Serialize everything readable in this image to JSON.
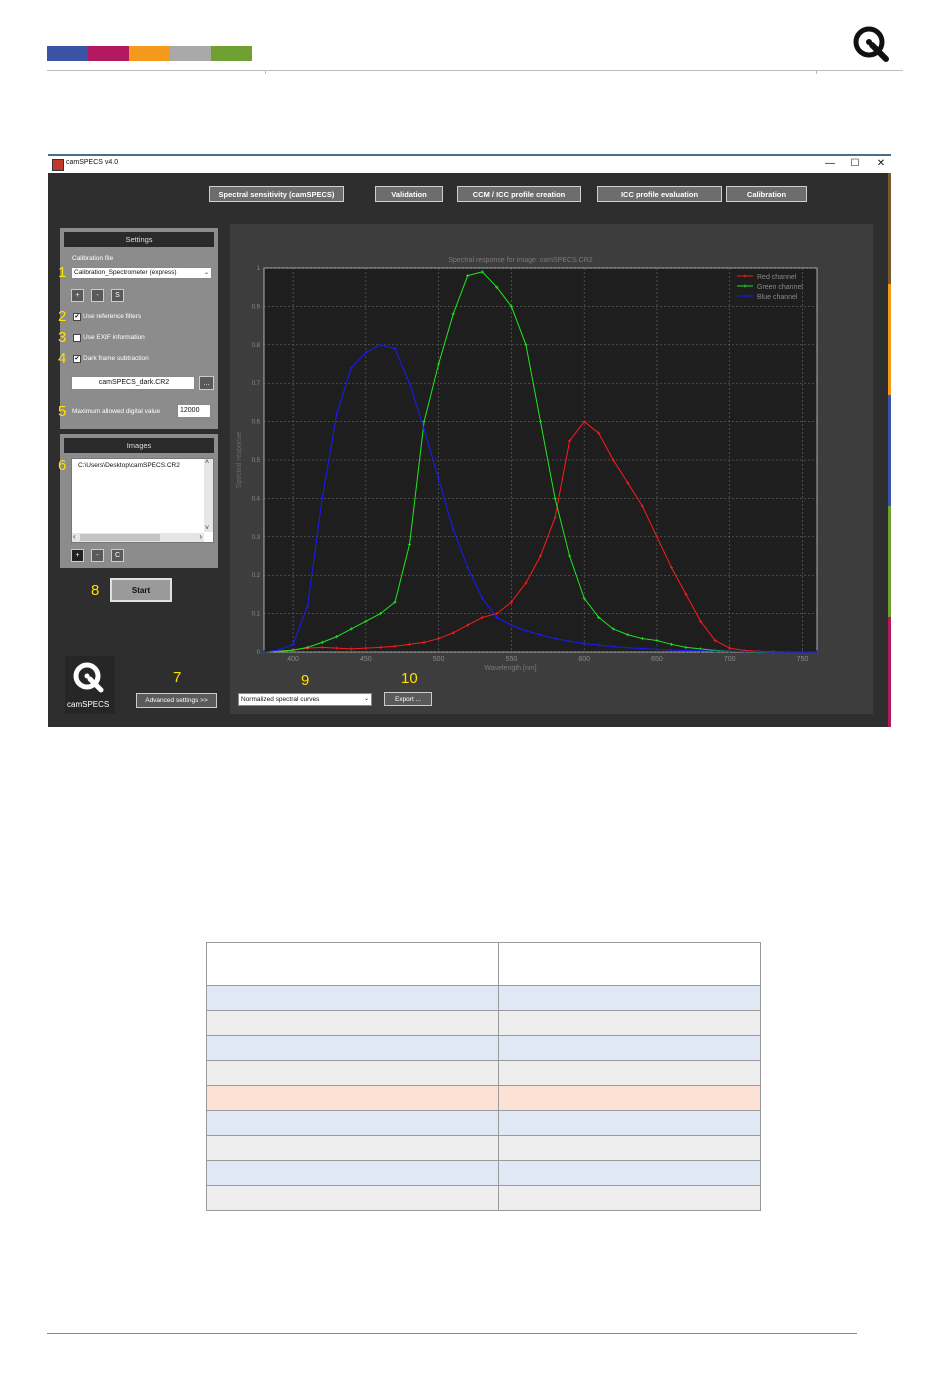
{
  "header": {
    "color_bar": [
      "#3a53a4",
      "#b3195f",
      "#f39a1c",
      "#a9a9a9",
      "#6fa033"
    ],
    "logo_icon": "image-engineering-logo-icon"
  },
  "window": {
    "title": "camSPECS v4.0",
    "controls": {
      "minimize": "—",
      "maximize": "☐",
      "close": "✕"
    },
    "side_colors": [
      "#7a5a2a",
      "#f39a1c",
      "#3a53a4",
      "#6fa033",
      "#b3195f"
    ]
  },
  "top_buttons": [
    "Spectral sensitivity (camSPECS)",
    "Validation",
    "CCM / ICC profile creation",
    "ICC profile evaluation",
    "Calibration"
  ],
  "settings": {
    "title": "Settings",
    "calibration_label": "Calibration file",
    "calibration_value": "Calibration_Spectrometer (express)",
    "cal_buttons": [
      "+",
      "-",
      "S"
    ],
    "use_reference_filters": {
      "label": "Use reference filters",
      "checked": "✔"
    },
    "use_exif": {
      "label": "Use EXIF information",
      "checked": ""
    },
    "dark_frame": {
      "label": "Dark frame subtraction",
      "checked": "✔"
    },
    "dark_file": "camSPECS_dark.CR2",
    "browse": "...",
    "max_label": "Maximum allowed digital value",
    "max_value": "12000"
  },
  "images": {
    "title": "Images",
    "files": [
      "C:\\Users\\Desktop\\camSPECS.CR2"
    ],
    "buttons": [
      "+",
      "-",
      "C"
    ],
    "scroll_up": "˄",
    "scroll_down": "˅",
    "scroll_left": "‹",
    "scroll_right": "›"
  },
  "start_label": "Start",
  "app_logo_text": "camSPECS",
  "advanced_label": "Advanced settings >>",
  "plot_mode": "Normalized spectral curves",
  "export_label": "Export ...",
  "markers": [
    "1",
    "2",
    "3",
    "4",
    "5",
    "6",
    "7",
    "8",
    "9",
    "10"
  ],
  "chart_data": {
    "type": "line",
    "title": "Spectral response for image: camSPECS.CR2",
    "xlabel": "Wavelength [nm]",
    "ylabel": "Spectral response",
    "xlim": [
      380,
      760
    ],
    "ylim": [
      0,
      1
    ],
    "xticks": [
      400,
      450,
      500,
      550,
      600,
      650,
      700,
      750
    ],
    "yticks": [
      0,
      0.1,
      0.2,
      0.3,
      0.4,
      0.5,
      0.6,
      0.7,
      0.8,
      0.9,
      1
    ],
    "grid": true,
    "legend_position": "top-right",
    "x": [
      380,
      390,
      400,
      410,
      420,
      430,
      440,
      450,
      460,
      470,
      480,
      490,
      500,
      510,
      520,
      530,
      540,
      550,
      560,
      570,
      580,
      590,
      600,
      610,
      620,
      630,
      640,
      650,
      660,
      670,
      680,
      690,
      700,
      710,
      720,
      730,
      740,
      750,
      760
    ],
    "series": [
      {
        "name": "Red channel",
        "color": "#ff1a1a",
        "values": [
          0.0,
          0.002,
          0.005,
          0.01,
          0.012,
          0.01,
          0.008,
          0.01,
          0.012,
          0.015,
          0.02,
          0.025,
          0.035,
          0.05,
          0.07,
          0.09,
          0.1,
          0.13,
          0.18,
          0.25,
          0.35,
          0.55,
          0.6,
          0.57,
          0.5,
          0.44,
          0.38,
          0.3,
          0.22,
          0.15,
          0.08,
          0.03,
          0.01,
          0.004,
          0.002,
          0.001,
          0.0,
          0.0,
          0.0
        ]
      },
      {
        "name": "Green channel",
        "color": "#1ee61e",
        "values": [
          0.0,
          0.002,
          0.005,
          0.012,
          0.025,
          0.04,
          0.06,
          0.08,
          0.1,
          0.13,
          0.28,
          0.6,
          0.75,
          0.88,
          0.98,
          0.99,
          0.95,
          0.9,
          0.8,
          0.6,
          0.4,
          0.25,
          0.14,
          0.09,
          0.06,
          0.045,
          0.035,
          0.03,
          0.02,
          0.012,
          0.008,
          0.004,
          0.002,
          0.001,
          0.0,
          0.0,
          0.0,
          0.0,
          0.0
        ]
      },
      {
        "name": "Blue channel",
        "color": "#1a1aff",
        "values": [
          0.0,
          0.005,
          0.02,
          0.12,
          0.4,
          0.62,
          0.74,
          0.78,
          0.8,
          0.79,
          0.7,
          0.58,
          0.45,
          0.32,
          0.22,
          0.14,
          0.09,
          0.07,
          0.055,
          0.045,
          0.035,
          0.028,
          0.022,
          0.018,
          0.014,
          0.011,
          0.009,
          0.007,
          0.005,
          0.004,
          0.003,
          0.002,
          0.002,
          0.001,
          0.001,
          0.0,
          0.0,
          0.0,
          0.0
        ]
      }
    ]
  },
  "table": {
    "rows": [
      {
        "style": "hdr",
        "cells": [
          "",
          ""
        ]
      },
      {
        "style": "blue",
        "cells": [
          "",
          ""
        ]
      },
      {
        "style": "gray",
        "cells": [
          "",
          ""
        ]
      },
      {
        "style": "blue",
        "cells": [
          "",
          ""
        ]
      },
      {
        "style": "gray",
        "cells": [
          "",
          ""
        ]
      },
      {
        "style": "orange",
        "cells": [
          "",
          ""
        ]
      },
      {
        "style": "blue",
        "cells": [
          "",
          ""
        ]
      },
      {
        "style": "gray",
        "cells": [
          "",
          ""
        ]
      },
      {
        "style": "blue",
        "cells": [
          "",
          ""
        ]
      },
      {
        "style": "gray",
        "cells": [
          "",
          ""
        ]
      }
    ]
  }
}
